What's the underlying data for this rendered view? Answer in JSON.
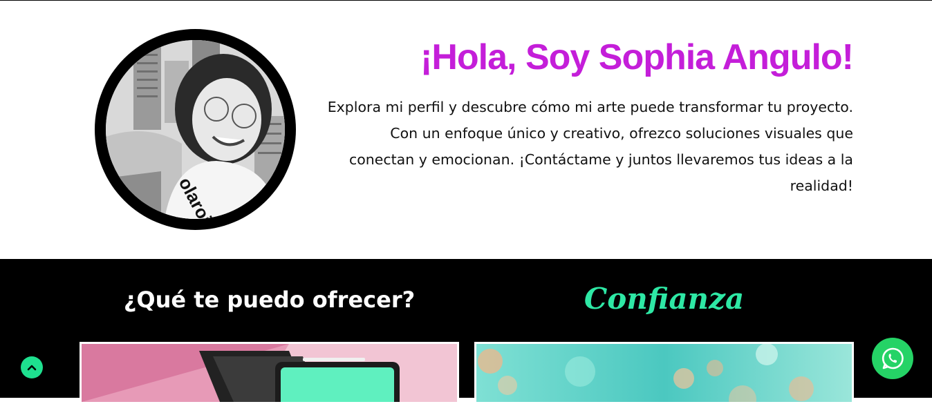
{
  "hero": {
    "title": "¡Hola, Soy Sophia Angulo!",
    "description": "Explora mi perfil y descubre cómo mi arte puede transformar tu proyecto. Con un enfoque único y creativo, ofrezco soluciones visuales que conectan y emocionan. ¡Contáctame y juntos llevaremos tus ideas a la realidad!",
    "avatar_shirt_text": "olaroid",
    "title_color": "#c41ed9"
  },
  "services": {
    "offer_title": "¿Qué te puedo ofrecer?",
    "trust_title": "Confianza",
    "trust_color": "#2ee8a5"
  },
  "floating": {
    "scroll_top_icon": "chevron-up-icon",
    "whatsapp_icon": "whatsapp-icon",
    "whatsapp_color": "#25d366",
    "scroll_top_color": "#1ee08f"
  }
}
